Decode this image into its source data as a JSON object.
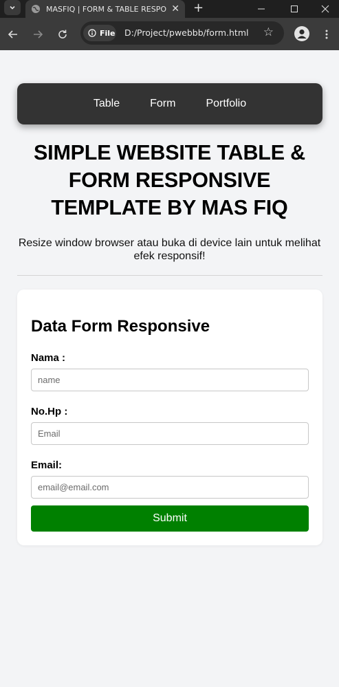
{
  "browser": {
    "tab_title": "MASFIQ | FORM & TABLE RESPONSIVE",
    "chip_label": "File",
    "url": "D:/Project/pwebbb/form.html"
  },
  "nav": {
    "items": [
      {
        "label": "Table"
      },
      {
        "label": "Form"
      },
      {
        "label": "Portfolio"
      }
    ]
  },
  "header": {
    "title": "SIMPLE WEBSITE TABLE & FORM RESPONSIVE TEMPLATE BY MAS FIQ",
    "subtitle": "Resize window browser atau buka di device lain untuk melihat efek responsif!"
  },
  "form": {
    "title": "Data Form Responsive",
    "fields": [
      {
        "label": "Nama :",
        "placeholder": "name",
        "value": ""
      },
      {
        "label": "No.Hp :",
        "placeholder": "Email",
        "value": ""
      },
      {
        "label": "Email:",
        "placeholder": "email@email.com",
        "value": ""
      }
    ],
    "submit_label": "Submit"
  },
  "colors": {
    "navbar": "#333333",
    "submit": "#008000",
    "page_bg": "#f3f4f6"
  }
}
